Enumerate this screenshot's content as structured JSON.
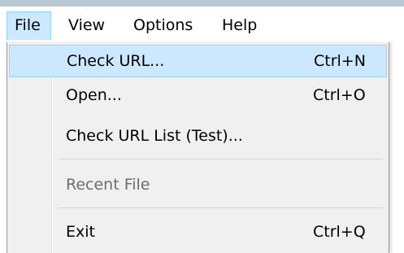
{
  "menubar": {
    "items": [
      {
        "label": "File",
        "active": true
      },
      {
        "label": "View",
        "active": false
      },
      {
        "label": "Options",
        "active": false
      },
      {
        "label": "Help",
        "active": false
      }
    ]
  },
  "file_menu": {
    "items": [
      {
        "label": "Check URL...",
        "shortcut": "Ctrl+N",
        "state": "highlighted"
      },
      {
        "label": "Open...",
        "shortcut": "Ctrl+O",
        "state": "enabled"
      },
      {
        "label": "Check URL List (Test)...",
        "shortcut": "",
        "state": "enabled"
      },
      {
        "label": "Recent File",
        "shortcut": "",
        "state": "disabled"
      },
      {
        "label": "Exit",
        "shortcut": "Ctrl+Q",
        "state": "enabled"
      }
    ]
  },
  "colors": {
    "highlight_fill": "#cce8ff",
    "highlight_border": "#99d1ff",
    "menu_background": "#f0f0f0",
    "disabled_text": "#6d6d6d",
    "window_edge": "#b9c7d4"
  }
}
